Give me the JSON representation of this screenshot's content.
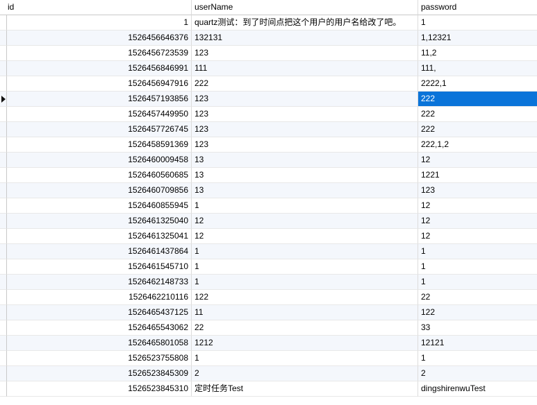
{
  "table": {
    "columns": {
      "id": "id",
      "userName": "userName",
      "password": "password"
    },
    "selected_row_index": 5,
    "selected_column": "password",
    "selection_color": "#0a74d9",
    "rows": [
      {
        "id": "1",
        "userName": "quartz测试：到了时间点把这个用户的用户名给改了吧。",
        "password": "1"
      },
      {
        "id": "1526456646376",
        "userName": "132131",
        "password": "1,12321"
      },
      {
        "id": "1526456723539",
        "userName": "123",
        "password": "11,2"
      },
      {
        "id": "1526456846991",
        "userName": "111",
        "password": "111,"
      },
      {
        "id": "1526456947916",
        "userName": "222",
        "password": "2222,1"
      },
      {
        "id": "1526457193856",
        "userName": "123",
        "password": "222"
      },
      {
        "id": "1526457449950",
        "userName": "123",
        "password": "222"
      },
      {
        "id": "1526457726745",
        "userName": "123",
        "password": "222"
      },
      {
        "id": "1526458591369",
        "userName": "123",
        "password": "222,1,2"
      },
      {
        "id": "1526460009458",
        "userName": "13",
        "password": "12"
      },
      {
        "id": "1526460560685",
        "userName": "13",
        "password": "1221"
      },
      {
        "id": "1526460709856",
        "userName": "13",
        "password": "123"
      },
      {
        "id": "1526460855945",
        "userName": "1",
        "password": "12"
      },
      {
        "id": "1526461325040",
        "userName": "12",
        "password": "12"
      },
      {
        "id": "1526461325041",
        "userName": "12",
        "password": "12"
      },
      {
        "id": "1526461437864",
        "userName": "1",
        "password": "1"
      },
      {
        "id": "1526461545710",
        "userName": "1",
        "password": "1"
      },
      {
        "id": "1526462148733",
        "userName": "1",
        "password": "1"
      },
      {
        "id": "1526462210116",
        "userName": "122",
        "password": "22"
      },
      {
        "id": "1526465437125",
        "userName": "11",
        "password": "122"
      },
      {
        "id": "1526465543062",
        "userName": "22",
        "password": "33"
      },
      {
        "id": "1526465801058",
        "userName": "1212",
        "password": "12121"
      },
      {
        "id": "1526523755808",
        "userName": "1",
        "password": "1"
      },
      {
        "id": "1526523845309",
        "userName": "2",
        "password": "2"
      },
      {
        "id": "1526523845310",
        "userName": "定时任务Test",
        "password": "dingshirenwuTest"
      }
    ]
  }
}
